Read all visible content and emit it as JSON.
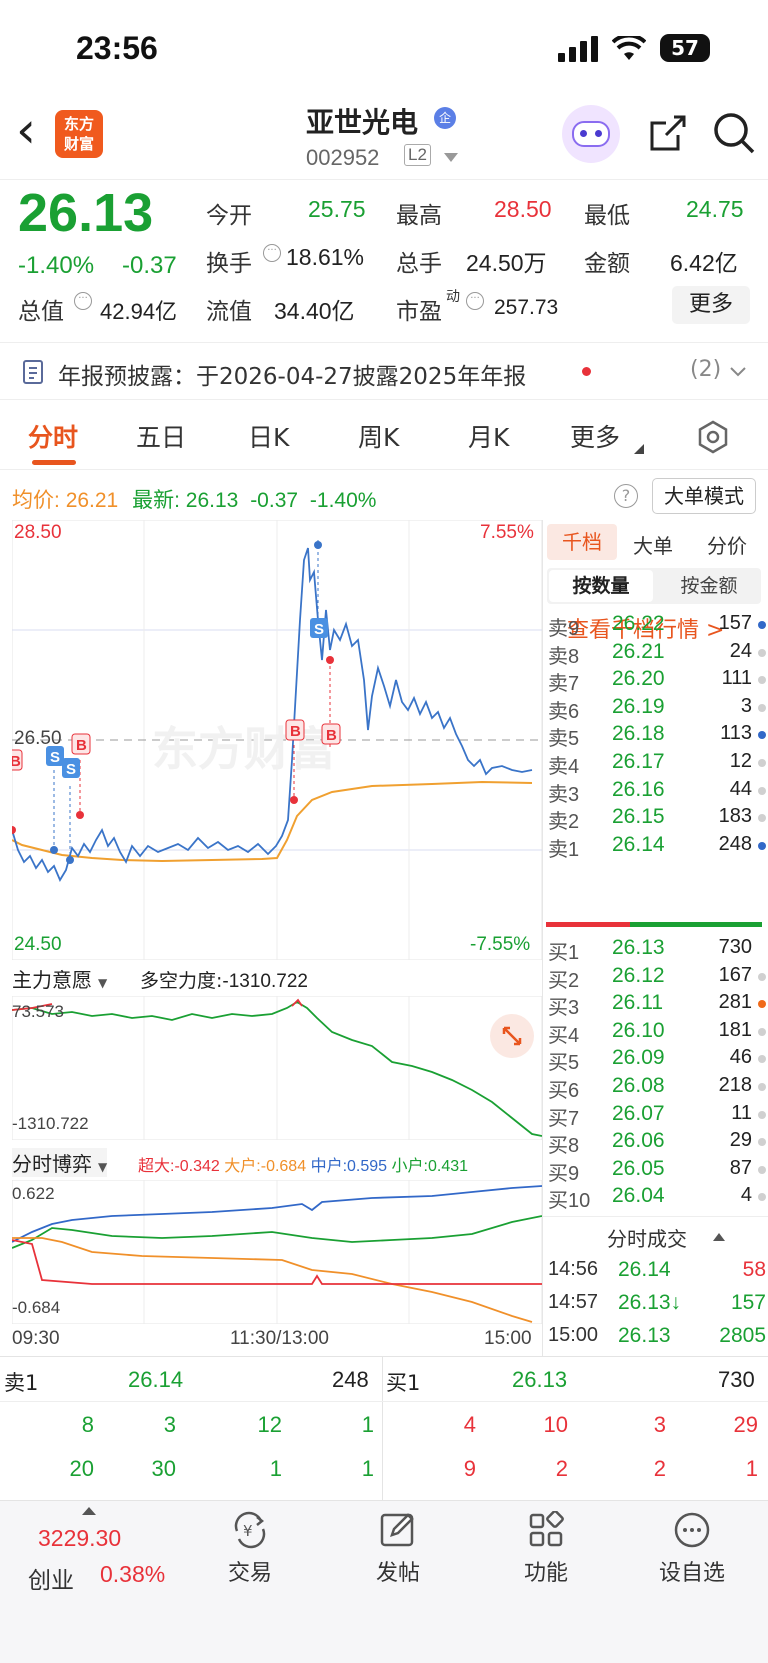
{
  "status": {
    "time": "23:56",
    "battery": "57"
  },
  "header": {
    "back": "‹",
    "logo_line1": "东方",
    "logo_line2": "财富",
    "name": "亚世光电",
    "name_badge": "企",
    "code": "002952",
    "level": "L2"
  },
  "quote": {
    "price": "26.13",
    "pct": "-1.40%",
    "chg": "-0.37",
    "open_label": "今开",
    "open": "25.75",
    "high_label": "最高",
    "high": "28.50",
    "low_label": "最低",
    "low": "24.75",
    "turnover_label": "换手",
    "turnover": "18.61%",
    "vol_label": "总手",
    "vol": "24.50万",
    "amount_label": "金额",
    "amount": "6.42亿",
    "mcap_label": "总值",
    "mcap": "42.94亿",
    "float_label": "流值",
    "float": "34.40亿",
    "pe_label": "市盈",
    "pe_sup": "动",
    "pe": "257.73",
    "more": "更多"
  },
  "notice": {
    "text": "年报预披露：于2026-04-27披露2025年年报",
    "count": "(2)"
  },
  "tabs": [
    "分时",
    "五日",
    "日K",
    "周K",
    "月K",
    "更多"
  ],
  "intraday": {
    "avg_label": "均价:",
    "avg": "26.21",
    "last_label": "最新:",
    "last": "26.13",
    "chg": "-0.37",
    "pct": "-1.40%",
    "big_order_mode": "大单模式",
    "y_top": "28.50",
    "y_mid": "26.50",
    "y_bot": "24.50",
    "pct_top": "7.55%",
    "pct_bot": "-7.55%",
    "ind1_title": "主力意愿",
    "ind1_label": "多空力度:",
    "ind1_value": "-1310.722",
    "ind1_top": "73.573",
    "ind1_bot": "-1310.722",
    "ind2_title": "分时博弈",
    "ind2_items": [
      {
        "name": "超大:",
        "value": "-0.342",
        "color": "#e8323a"
      },
      {
        "name": "大户:",
        "value": "-0.684",
        "color": "#f0902a"
      },
      {
        "name": "中户:",
        "value": "0.595",
        "color": "#3268c8"
      },
      {
        "name": "小户:",
        "value": "0.431",
        "color": "#1aa033"
      }
    ],
    "ind2_top": "0.622",
    "ind2_bot": "-0.684",
    "time_start": "09:30",
    "time_mid": "11:30/13:00",
    "time_end": "15:00",
    "watermark": "东方财富"
  },
  "orderbook": {
    "tabs": [
      "千档",
      "大单",
      "分价"
    ],
    "subtabs": [
      "按数量",
      "按金额"
    ],
    "link": "查看千档行情 >",
    "asks": [
      {
        "label": "卖9",
        "price": "26.22",
        "vol": "157",
        "dot": "#3268c8"
      },
      {
        "label": "卖8",
        "price": "26.21",
        "vol": "24",
        "dot": "#d0d0d0"
      },
      {
        "label": "卖7",
        "price": "26.20",
        "vol": "111",
        "dot": "#d0d0d0"
      },
      {
        "label": "卖6",
        "price": "26.19",
        "vol": "3",
        "dot": "#d0d0d0"
      },
      {
        "label": "卖5",
        "price": "26.18",
        "vol": "113",
        "dot": "#3268c8"
      },
      {
        "label": "卖4",
        "price": "26.17",
        "vol": "12",
        "dot": "#d0d0d0"
      },
      {
        "label": "卖3",
        "price": "26.16",
        "vol": "44",
        "dot": "#d0d0d0"
      },
      {
        "label": "卖2",
        "price": "26.15",
        "vol": "183",
        "dot": "#d0d0d0"
      },
      {
        "label": "卖1",
        "price": "26.14",
        "vol": "248",
        "dot": "#3268c8"
      }
    ],
    "bids": [
      {
        "label": "买1",
        "price": "26.13",
        "vol": "730",
        "dot": ""
      },
      {
        "label": "买2",
        "price": "26.12",
        "vol": "167",
        "dot": "#d0d0d0"
      },
      {
        "label": "买3",
        "price": "26.11",
        "vol": "281",
        "dot": "#f06a1a"
      },
      {
        "label": "买4",
        "price": "26.10",
        "vol": "181",
        "dot": "#d0d0d0"
      },
      {
        "label": "买5",
        "price": "26.09",
        "vol": "46",
        "dot": "#d0d0d0"
      },
      {
        "label": "买6",
        "price": "26.08",
        "vol": "218",
        "dot": "#d0d0d0"
      },
      {
        "label": "买7",
        "price": "26.07",
        "vol": "11",
        "dot": "#d0d0d0"
      },
      {
        "label": "买8",
        "price": "26.06",
        "vol": "29",
        "dot": "#d0d0d0"
      },
      {
        "label": "买9",
        "price": "26.05",
        "vol": "87",
        "dot": "#d0d0d0"
      },
      {
        "label": "买10",
        "price": "26.04",
        "vol": "4",
        "dot": "#d0d0d0"
      }
    ],
    "ticks_title": "分时成交",
    "ticks": [
      {
        "time": "14:56",
        "price": "26.14",
        "vol": "58",
        "color": "#e8323a"
      },
      {
        "time": "14:57",
        "price": "26.13↓",
        "vol": "157",
        "color": "#1aa033"
      },
      {
        "time": "15:00",
        "price": "26.13",
        "vol": "2805",
        "color": "#1aa033"
      }
    ]
  },
  "queue": {
    "sell_label": "卖1",
    "sell_price": "26.14",
    "sell_vol": "248",
    "buy_label": "买1",
    "buy_price": "26.13",
    "buy_vol": "730",
    "sell_rows": [
      [
        "8",
        "3",
        "12",
        "1"
      ],
      [
        "20",
        "30",
        "1",
        "1"
      ]
    ],
    "buy_rows": [
      [
        "4",
        "10",
        "3",
        "29"
      ],
      [
        "9",
        "2",
        "2",
        "1"
      ]
    ]
  },
  "bottom": {
    "index_value": "3229.30",
    "index_name": "创业",
    "index_pct": "0.38%",
    "items": [
      {
        "label": "交易",
        "icon": "yuan-cycle-icon"
      },
      {
        "label": "发帖",
        "icon": "edit-icon"
      },
      {
        "label": "功能",
        "icon": "grid-icon"
      },
      {
        "label": "设自选",
        "icon": "more-icon"
      }
    ]
  },
  "colors": {
    "up": "#e8323a",
    "down": "#1aa033",
    "accent": "#e8551e",
    "avg": "#f0a030",
    "price": "#3a74c8"
  }
}
